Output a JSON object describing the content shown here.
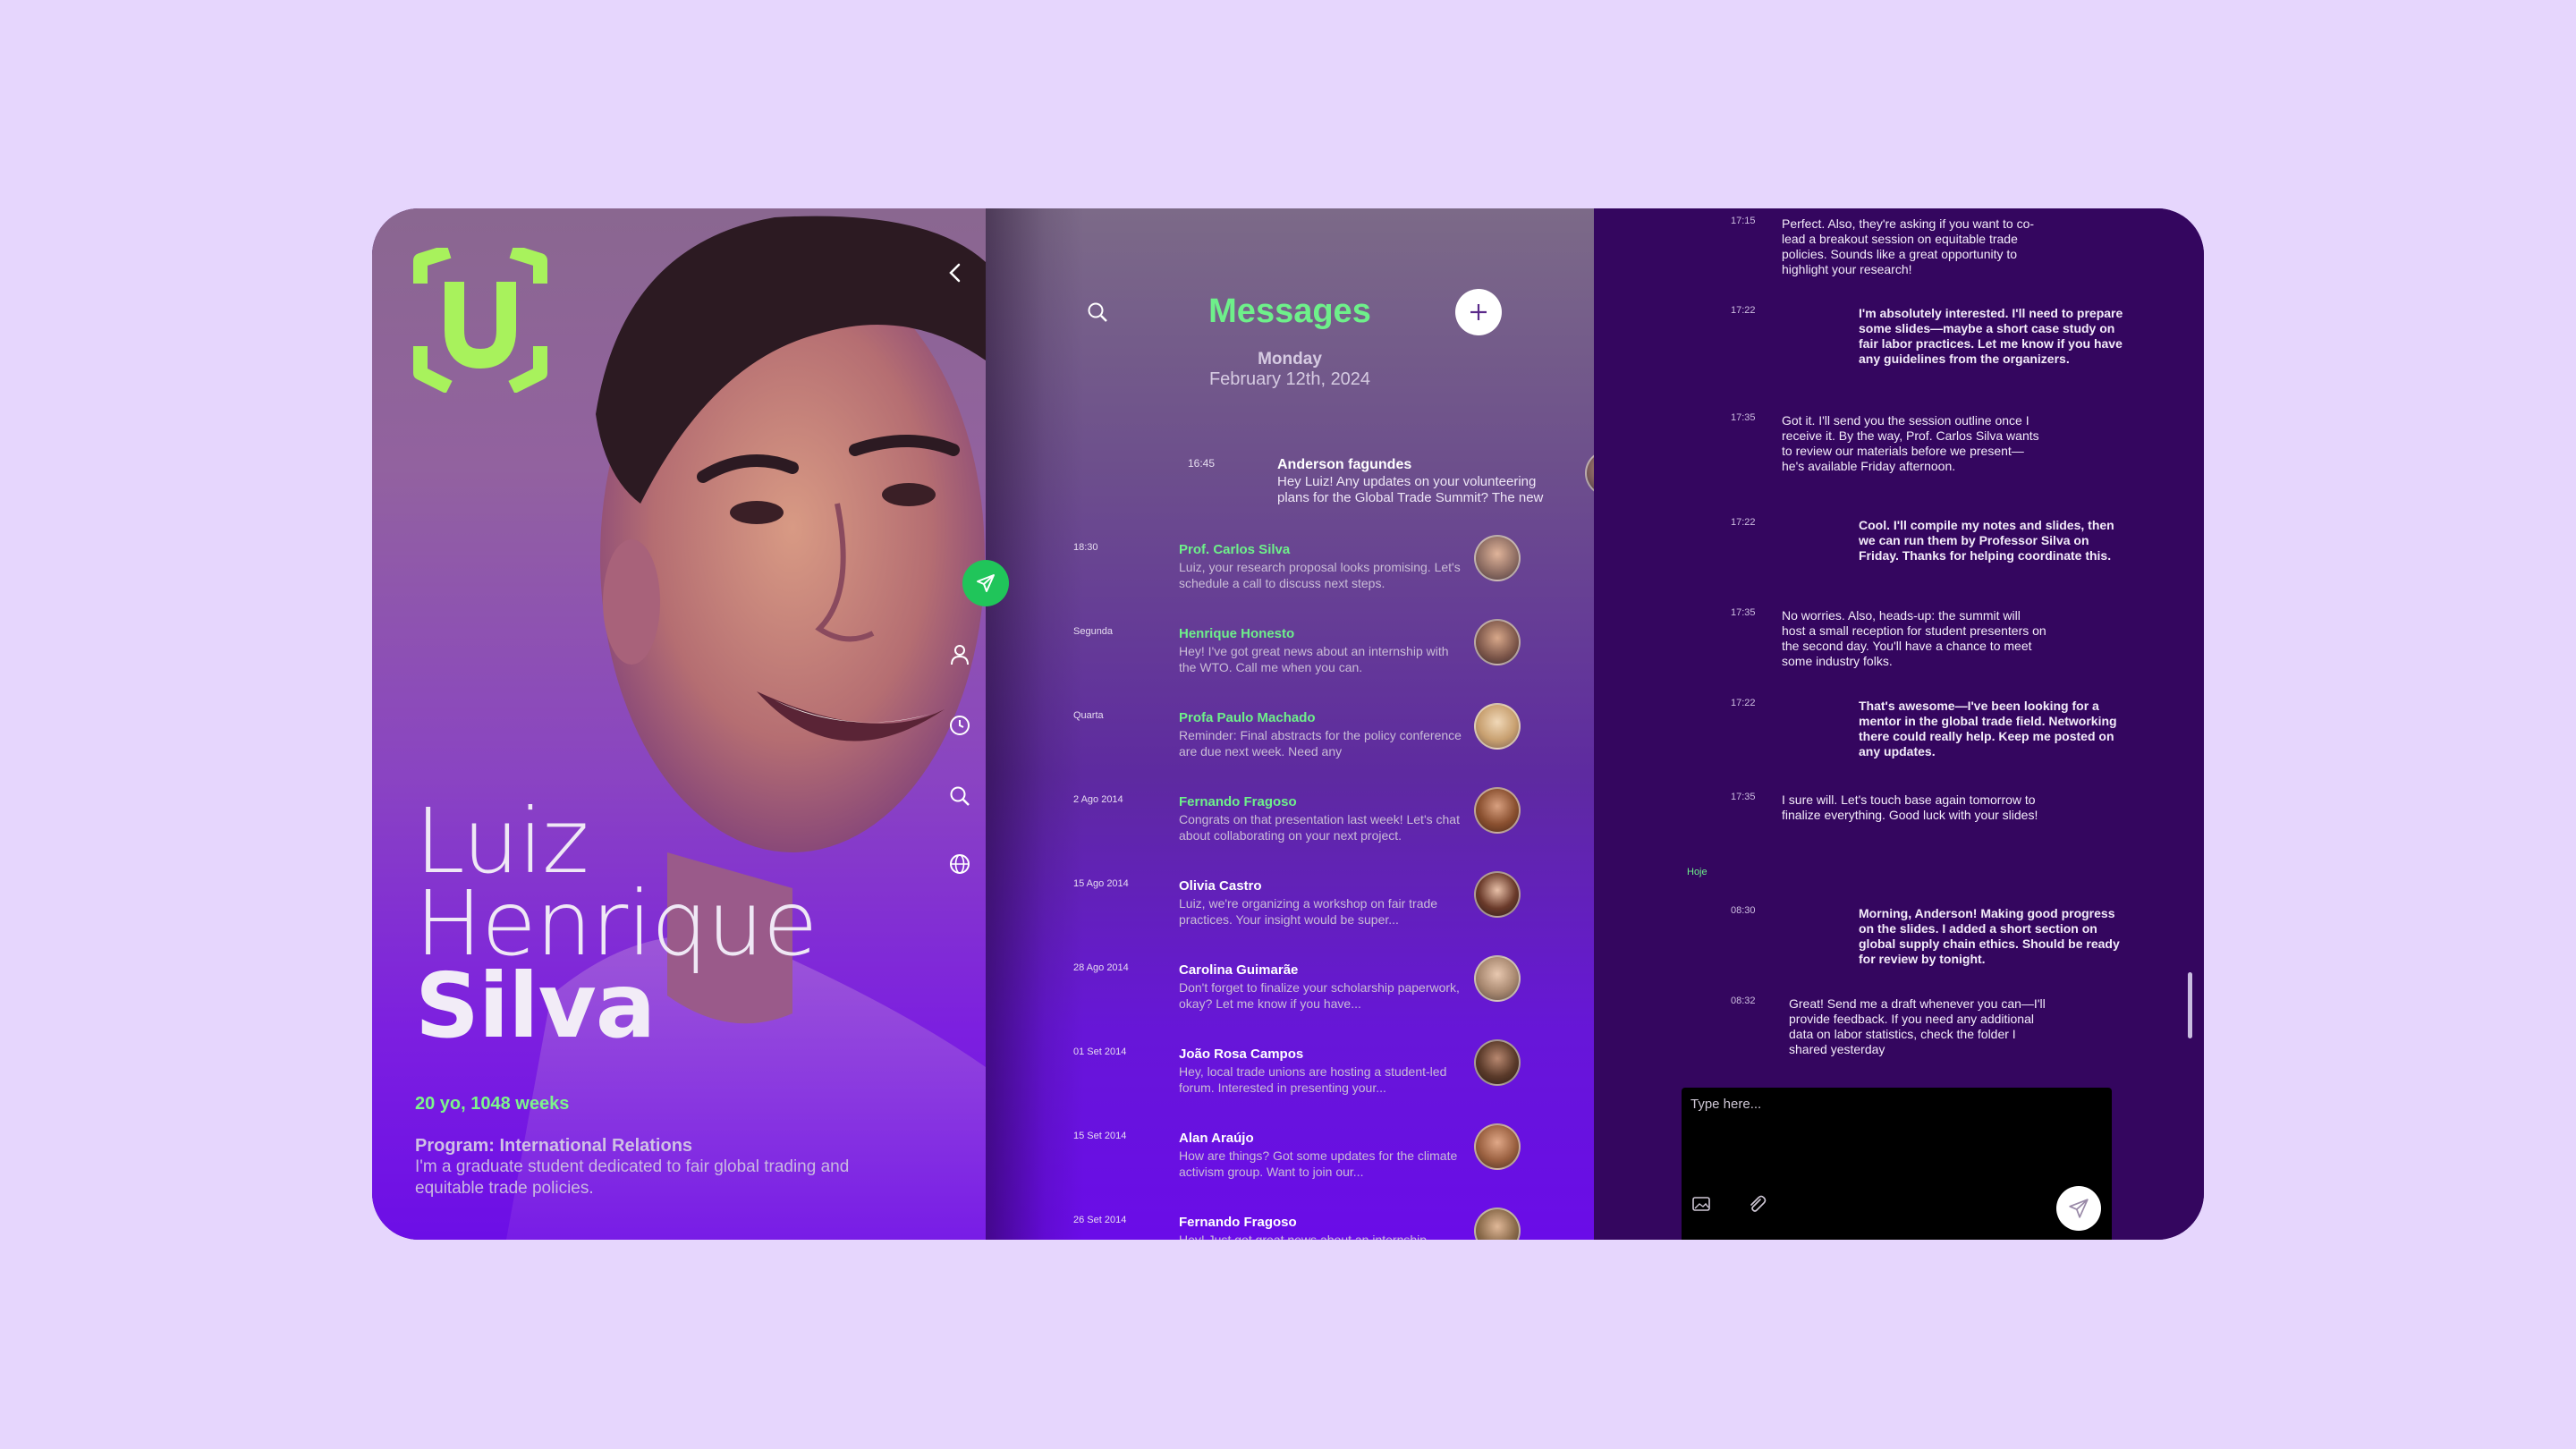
{
  "profile": {
    "first_name": "Luiz",
    "middle_name": "Henrique",
    "last_name": "Silva",
    "age": "20 yo, 1048 weeks",
    "program": "Program: International Relations",
    "bio": "I'm a graduate student dedicated to fair global trading and equitable trade policies."
  },
  "colors": {
    "accent_green": "#6ef08a",
    "chat_background": "#34065f",
    "page_background": "#e6d6fd",
    "send_button": "#20c55a"
  },
  "nav": {
    "items": [
      "send-icon",
      "user-icon",
      "clock-icon",
      "search-icon",
      "globe-icon"
    ]
  },
  "messages": {
    "title": "Messages",
    "day": "Monday",
    "date": "February 12th, 2024",
    "featured": {
      "time": "16:45",
      "sender": "Anderson fagundes",
      "preview": "Hey Luiz! Any updates on your volunteering plans for the Global Trade Summit? The new"
    },
    "conversations": [
      {
        "time": "18:30",
        "sender": "Prof. Carlos Silva",
        "preview": "Luiz, your research proposal looks promising. Let's schedule a call to discuss next steps.",
        "sender_color": "#6ef08a"
      },
      {
        "time": "Segunda",
        "sender": "Henrique Honesto",
        "preview": "Hey! I've got great news about an internship with the WTO. Call me when you can.",
        "sender_color": "#6ef08a"
      },
      {
        "time": "Quarta",
        "sender": "Profa Paulo Machado",
        "preview": "Reminder: Final abstracts for the policy conference are due next week. Need any",
        "sender_color": "#6ef08a"
      },
      {
        "time": "2 Ago 2014",
        "sender": "Fernando Fragoso",
        "preview": "Congrats on that presentation last week! Let's chat about collaborating on your next project.",
        "sender_color": "#6ef08a"
      },
      {
        "time": "15 Ago 2014",
        "sender": "Olivia Castro",
        "preview": "Luiz, we're organizing a workshop on fair trade practices. Your insight would be super...",
        "sender_color": "#ffffff"
      },
      {
        "time": "28 Ago 2014",
        "sender": "Carolina Guimarãe",
        "preview": "Don't forget to finalize your scholarship paperwork, okay? Let me know if you have...",
        "sender_color": "#ffffff"
      },
      {
        "time": "01 Set 2014",
        "sender": "João Rosa Campos",
        "preview": "Hey, local trade unions are hosting a student-led forum. Interested in presenting your...",
        "sender_color": "#ffffff"
      },
      {
        "time": "15 Set 2014",
        "sender": "Alan Araújo",
        "preview": "How are things? Got some updates for the climate activism group. Want to join our...",
        "sender_color": "#ffffff"
      },
      {
        "time": "26 Set 2014",
        "sender": "Fernando Fragoso",
        "preview": "Hey! Just got great news about an internship",
        "sender_color": "#ffffff"
      }
    ]
  },
  "chat": {
    "today_label": "Hoje",
    "composer_placeholder": "Type here...",
    "messages": [
      {
        "time": "17:15",
        "text": "Perfect. Also, they're asking if you want to co-lead a breakout session on equitable trade policies. Sounds like a great opportunity to highlight your research!",
        "own": false
      },
      {
        "time": "17:22",
        "text": "I'm absolutely interested. I'll need to prepare some slides—maybe a short case study on fair labor practices. Let me know if you have any guidelines from the organizers.",
        "own": true
      },
      {
        "time": "17:35",
        "text": "Got it. I'll send you the session outline once I receive it. By the way, Prof. Carlos Silva wants to review our materials before we present—he's available Friday afternoon.",
        "own": false
      },
      {
        "time": "17:22",
        "text": "Cool. I'll compile my notes and slides, then we can run them by Professor Silva on Friday. Thanks for helping coordinate this.",
        "own": true
      },
      {
        "time": "17:35",
        "text": "No worries. Also, heads-up: the summit will host a small reception for student presenters on the second day. You'll have a chance to meet some industry folks.",
        "own": false
      },
      {
        "time": "17:22",
        "text": "That's awesome—I've been looking for a mentor in the global trade field. Networking there could really help. Keep me posted on any updates.",
        "own": true
      },
      {
        "time": "17:35",
        "text": "I sure will. Let's touch base again tomorrow to finalize everything. Good luck with your slides!",
        "own": false
      },
      {
        "time": "08:30",
        "text": "Morning, Anderson! Making good progress on the slides. I added a short section on global supply chain ethics. Should be ready for review by tonight.",
        "own": true
      },
      {
        "time": "08:32",
        "text": "Great! Send me a draft whenever you can—I'll provide feedback. If you need any additional data on labor statistics, check the folder I shared yesterday",
        "own": false
      }
    ]
  }
}
